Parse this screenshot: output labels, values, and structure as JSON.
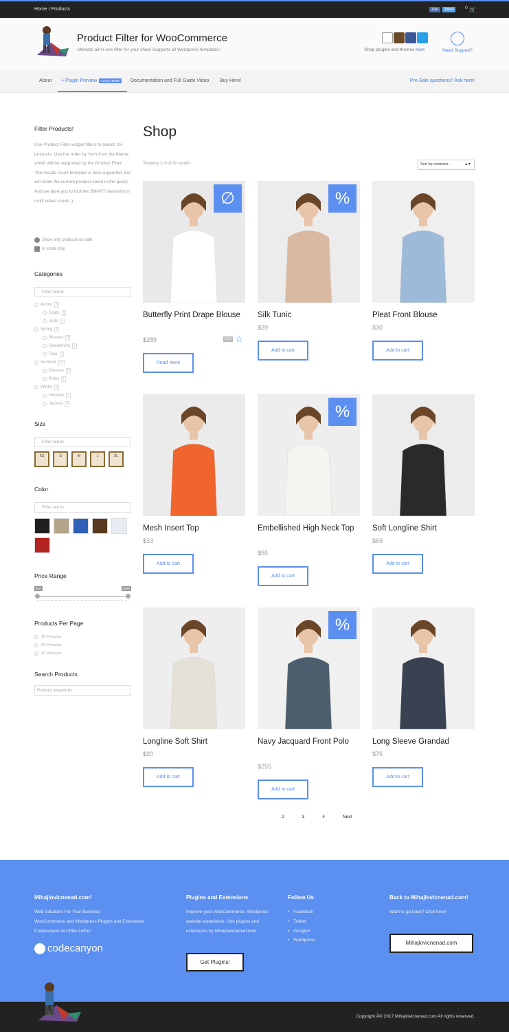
{
  "topbar": {
    "breadcrumb": "Home / Products",
    "like_label": "Like",
    "tweet_label": "Tweet",
    "cart_count": "0"
  },
  "header": {
    "title": "Product Filter for WooCommerce",
    "tagline": "Ultimate all-in-one filter for your shop! Supports all Wordpress templates!",
    "shop_text": "Shop plugins and themes",
    "shop_link": "here",
    "support_label": "Need Support?"
  },
  "nav": {
    "items": [
      "About",
      "Plugin Preview",
      "Documentation and Full Guide Video",
      "Buy Here!"
    ],
    "badge": "CLICK HERE!",
    "presale": "Pre-Sale questions? Ask here!"
  },
  "sidebar": {
    "filter_title": "Filter Products!",
    "filter_desc": "Use Product Filter widget filters to search for products. Use the order by form from the theme, which will be supported by the Product Filter. The results count template is also supported and will show the current product count in the query. And we dare you to fool the SMART hierarchy in multi select mode ;)",
    "onsale": "Show only products on sale",
    "instock": "In stock only",
    "categories_title": "Categories",
    "filter_placeholder": "Filter terms",
    "categories": [
      {
        "label": "Autmn",
        "level": 0,
        "count": "3"
      },
      {
        "label": "Coats",
        "level": 1,
        "count": "3"
      },
      {
        "label": "Suits",
        "level": 1,
        "count": "1"
      },
      {
        "label": "Spring",
        "level": 0,
        "count": "6"
      },
      {
        "label": "Blouses",
        "level": 1,
        "count": "3"
      },
      {
        "label": "Sweatshirts",
        "level": 1,
        "count": "2"
      },
      {
        "label": "Tops",
        "level": 1,
        "count": "1"
      },
      {
        "label": "Summer",
        "level": 0,
        "count": "14"
      },
      {
        "label": "Dresses",
        "level": 1,
        "count": "6"
      },
      {
        "label": "Polos",
        "level": 1,
        "count": "1"
      },
      {
        "label": "Winter",
        "level": 0,
        "count": "9"
      },
      {
        "label": "Hoodies",
        "level": 1,
        "count": "2"
      },
      {
        "label": "Jackets",
        "level": 1,
        "count": "4"
      }
    ],
    "size_title": "Size",
    "sizes": [
      "XS",
      "S",
      "M",
      "L",
      "XL"
    ],
    "color_title": "Color",
    "colors": [
      "#1f1f1f",
      "#b3a48a",
      "#3160b8",
      "#5a3a1e",
      "#e7ebf2",
      "#b3231f"
    ],
    "price_title": "Price Range",
    "price_min": "$20",
    "price_max": "$289",
    "ppp_title": "Products Per Page",
    "ppp_options": [
      "10 Products",
      "20 Products",
      "30 Products"
    ],
    "search_title": "Search Products",
    "search_placeholder": "Product keywords"
  },
  "shop": {
    "title": "Shop",
    "showing": "Showing 1–9 of 30 results",
    "sort": "Sort by newness",
    "products": [
      {
        "name": "Butterfly Print Drape Blouse",
        "price": "$289",
        "button": "Read more",
        "badge": "∅",
        "rating": "5.00"
      },
      {
        "name": "Silk Tunic",
        "price": "$29",
        "button": "Add to cart",
        "badge": "%"
      },
      {
        "name": "Pleat Front Blouse",
        "price": "$30",
        "button": "Add to cart",
        "badge": ""
      },
      {
        "name": "Mesh Insert Top",
        "price": "$33",
        "button": "Add to cart",
        "badge": ""
      },
      {
        "name": "Embellished High Neck Top",
        "price": "$55",
        "button": "Add to cart",
        "badge": "%"
      },
      {
        "name": "Soft Longline Shirt",
        "price": "$69",
        "button": "Add to cart",
        "badge": ""
      },
      {
        "name": "Longline Soft Shirt",
        "price": "$20",
        "button": "Add to cart",
        "badge": ""
      },
      {
        "name": "Navy Jacquard Front Polo",
        "price": "$255",
        "button": "Add to cart",
        "badge": "%"
      },
      {
        "name": "Long Sleeve Grandad",
        "price": "$75",
        "button": "Add to cart",
        "badge": ""
      }
    ],
    "pages": [
      "2",
      "3",
      "4",
      "Next"
    ]
  },
  "footer": {
    "col1_title": "Mihajlovicnenad.com!",
    "col1_lines": [
      "Web Solutions For Your Business",
      "WooCommerce and Wordpress Plugins and Extensions",
      "Codecanyon.net Elite Author"
    ],
    "codecanyon": "codecanyon",
    "col2_title": "Plugins and Extensions",
    "col2_text": "Improve your WooCommerce, Wordpress website experience. Use plugins and extensions by Mihajlovicnenad.com",
    "col2_button": "Get Plugins!",
    "col3_title": "Follow Us",
    "col3_links": [
      "Facebook",
      "Twitter",
      "Google+",
      "Wordpress"
    ],
    "col4_title": "Back to Mihajlovicnenad.com!",
    "col4_text": "Want to go back? Click here!",
    "col4_button": "Mihajlovicnenad.com",
    "copyright": "Copyright Â© 2017 Mihajlovicnenad.com All rights reserved."
  },
  "colors": {
    "accent": "#5b8ff0",
    "dark": "#222222"
  }
}
